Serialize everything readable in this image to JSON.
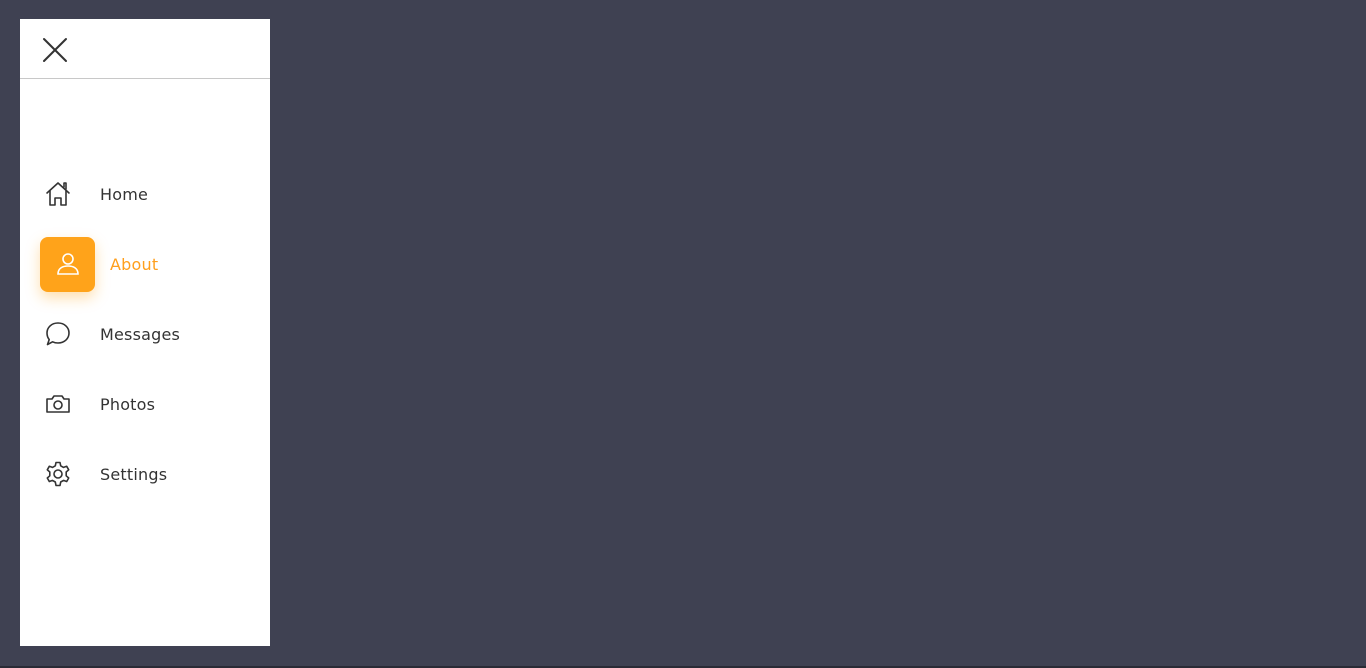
{
  "colors": {
    "background": "#3f4152",
    "sidebar": "#ffffff",
    "accent": "#ffa31a",
    "text": "#333333"
  },
  "sidebar": {
    "close_icon": "close-icon",
    "items": [
      {
        "label": "Home",
        "icon": "home-icon",
        "active": false
      },
      {
        "label": "About",
        "icon": "user-icon",
        "active": true
      },
      {
        "label": "Messages",
        "icon": "chat-bubble-icon",
        "active": false
      },
      {
        "label": "Photos",
        "icon": "camera-icon",
        "active": false
      },
      {
        "label": "Settings",
        "icon": "gear-icon",
        "active": false
      }
    ]
  }
}
